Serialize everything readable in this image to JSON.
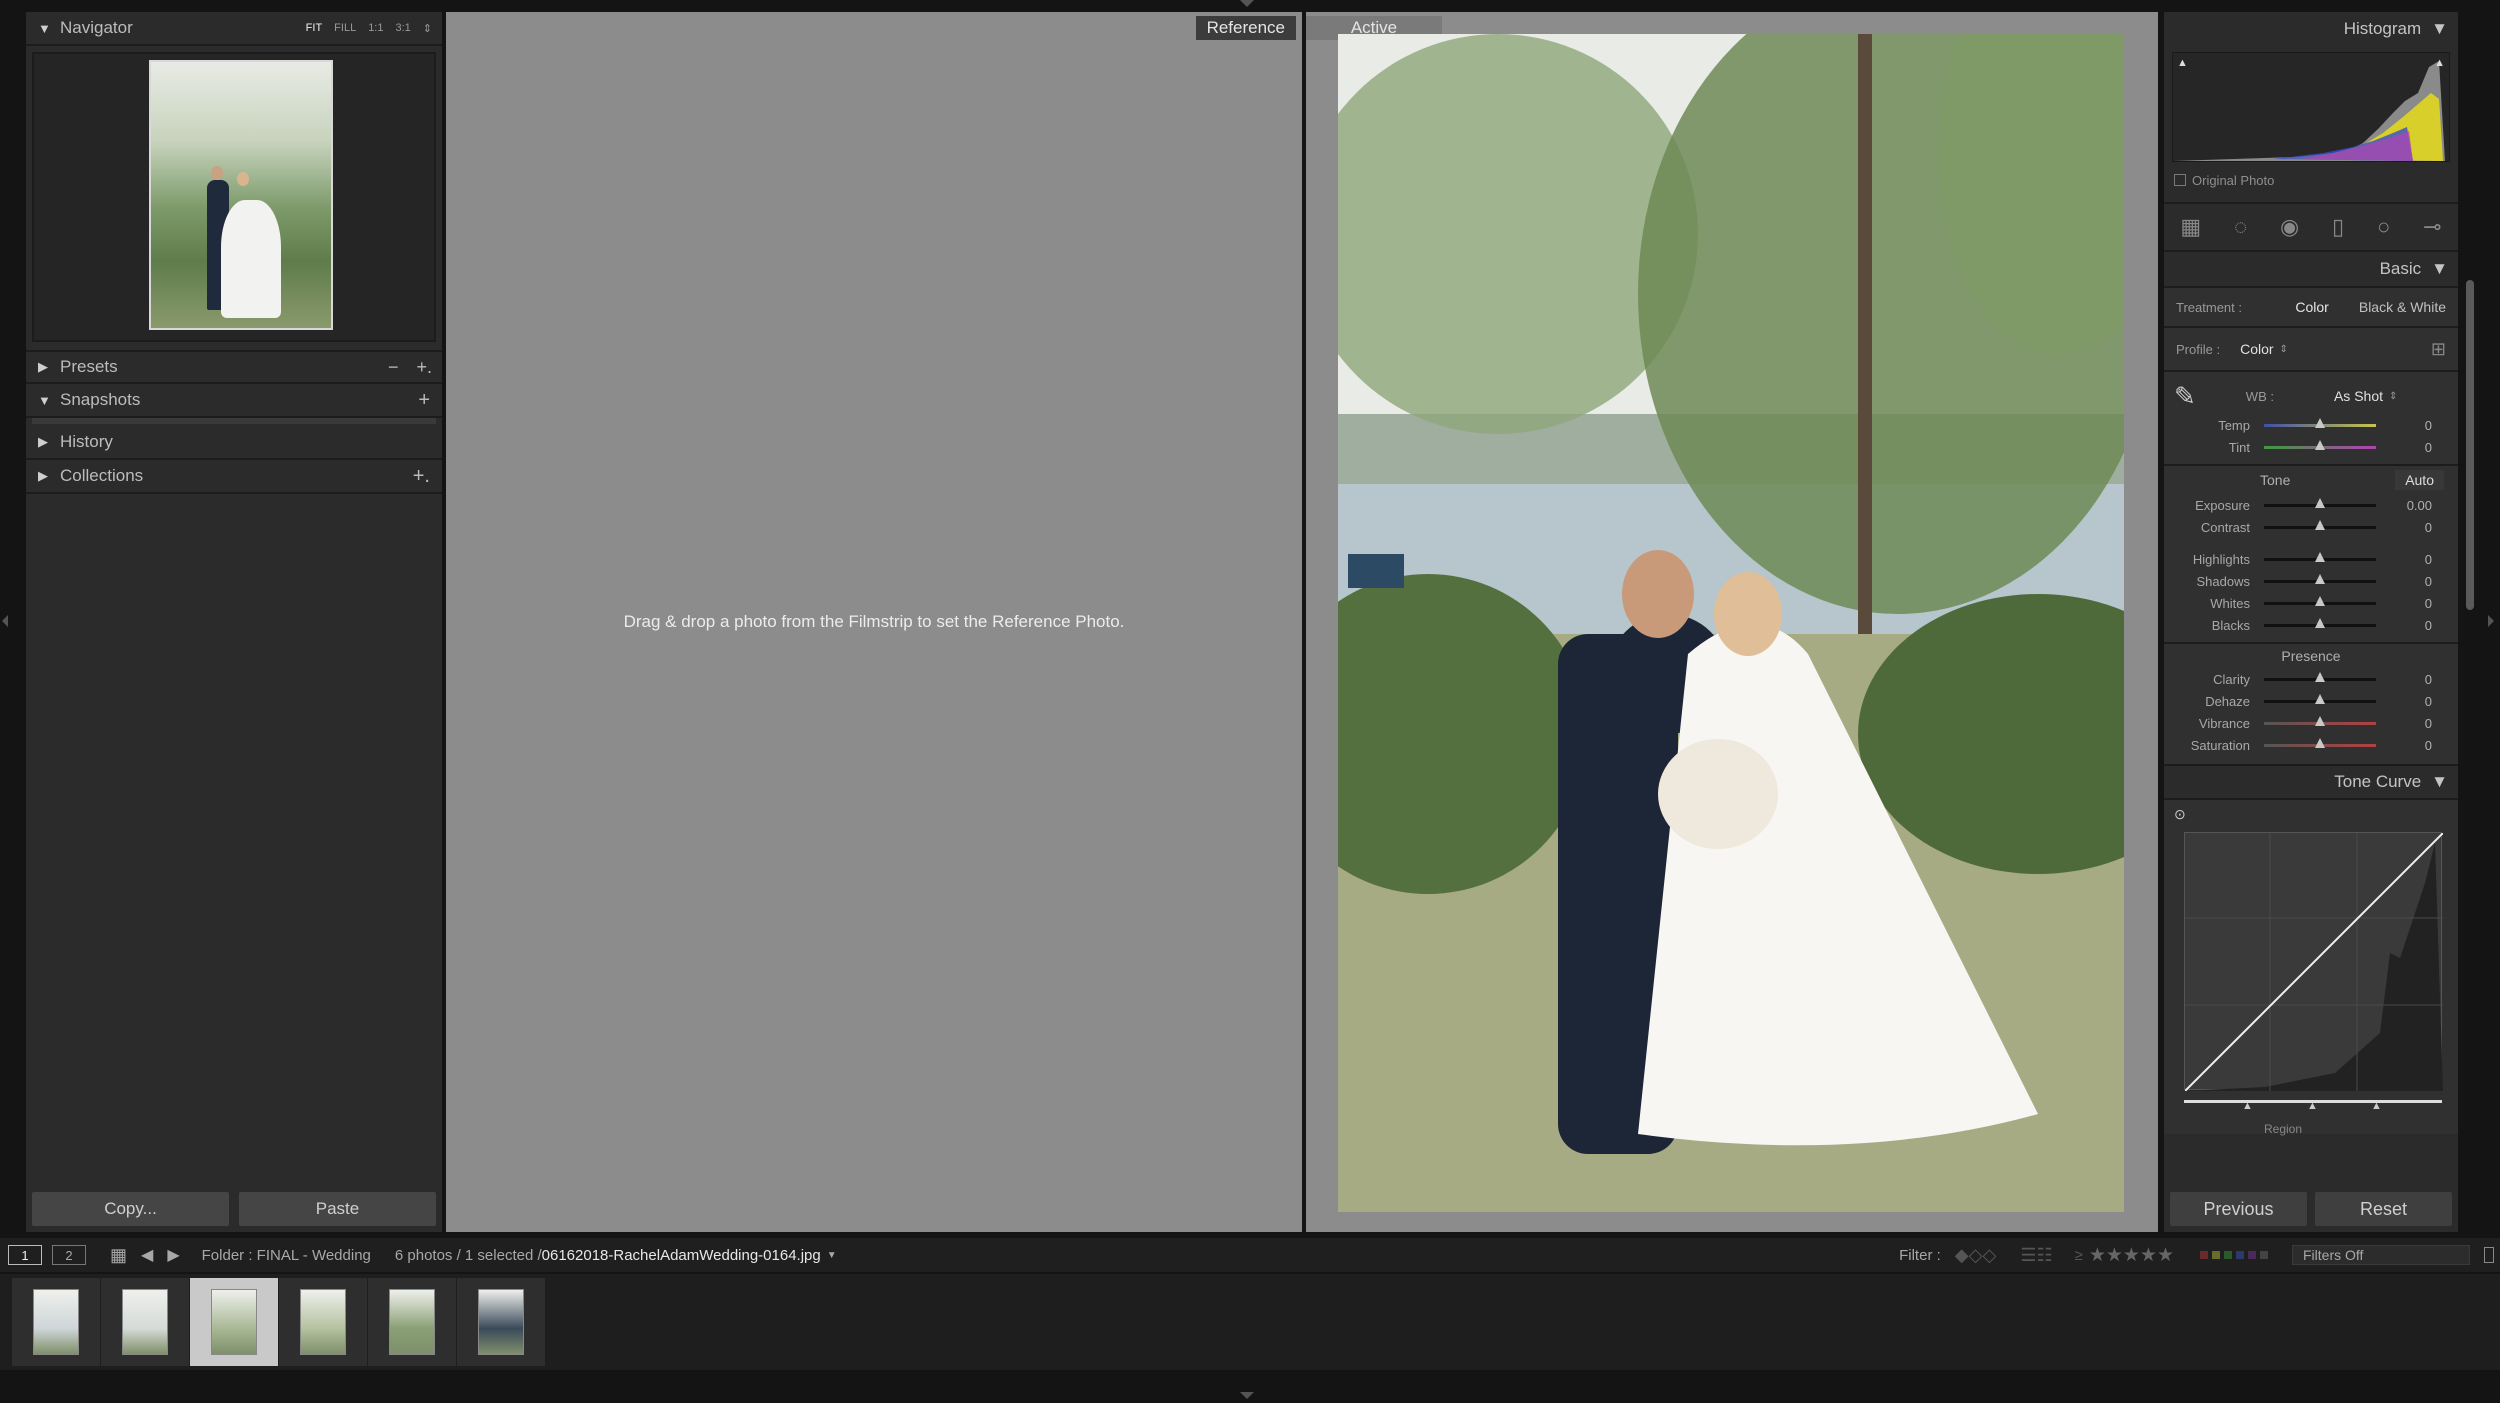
{
  "left_panel": {
    "navigator": {
      "title": "Navigator",
      "zoom_options": [
        "FIT",
        "FILL",
        "1:1",
        "3:1"
      ]
    },
    "presets": {
      "title": "Presets",
      "minus": "−",
      "plus": "+."
    },
    "snapshots": {
      "title": "Snapshots",
      "plus": "+"
    },
    "history": {
      "title": "History"
    },
    "collections": {
      "title": "Collections",
      "plus": "+."
    },
    "copy_label": "Copy...",
    "paste_label": "Paste"
  },
  "center": {
    "reference_tag": "Reference",
    "active_tag": "Active",
    "drag_message": "Drag & drop a photo from the Filmstrip to set the Reference Photo."
  },
  "right_panel": {
    "histogram_title": "Histogram",
    "original_photo_label": "Original Photo",
    "basic_title": "Basic",
    "treatment_label": "Treatment :",
    "treatment_color": "Color",
    "treatment_bw": "Black & White",
    "profile_label": "Profile :",
    "profile_value": "Color",
    "wb_label": "WB :",
    "wb_value": "As Shot",
    "tone_label": "Tone",
    "auto_label": "Auto",
    "presence_label": "Presence",
    "sliders": [
      {
        "label": "Temp",
        "value": "0",
        "pos": 0.5
      },
      {
        "label": "Tint",
        "value": "0",
        "pos": 0.5
      },
      {
        "label": "Exposure",
        "value": "0.00",
        "pos": 0.5
      },
      {
        "label": "Contrast",
        "value": "0",
        "pos": 0.5
      },
      {
        "label": "Highlights",
        "value": "0",
        "pos": 0.5
      },
      {
        "label": "Shadows",
        "value": "0",
        "pos": 0.5
      },
      {
        "label": "Whites",
        "value": "0",
        "pos": 0.5
      },
      {
        "label": "Blacks",
        "value": "0",
        "pos": 0.5
      },
      {
        "label": "Clarity",
        "value": "0",
        "pos": 0.5
      },
      {
        "label": "Dehaze",
        "value": "0",
        "pos": 0.5
      },
      {
        "label": "Vibrance",
        "value": "0",
        "pos": 0.5
      },
      {
        "label": "Saturation",
        "value": "0",
        "pos": 0.5
      }
    ],
    "tone_curve_title": "Tone Curve",
    "region_label": "Region",
    "previous_label": "Previous",
    "reset_label": "Reset"
  },
  "bottom_bar": {
    "screen1": "1",
    "screen2": "2",
    "folder_text": "Folder : FINAL - Wedding",
    "count_text": "6 photos / 1 selected /",
    "filename": "06162018-RachelAdamWedding-0164.jpg",
    "filter_label": "Filter :",
    "rating_op": "≥",
    "stars": "★★★★★",
    "filters_off": "Filters Off"
  },
  "filmstrip": {
    "count": 6,
    "selected_index": 2
  }
}
